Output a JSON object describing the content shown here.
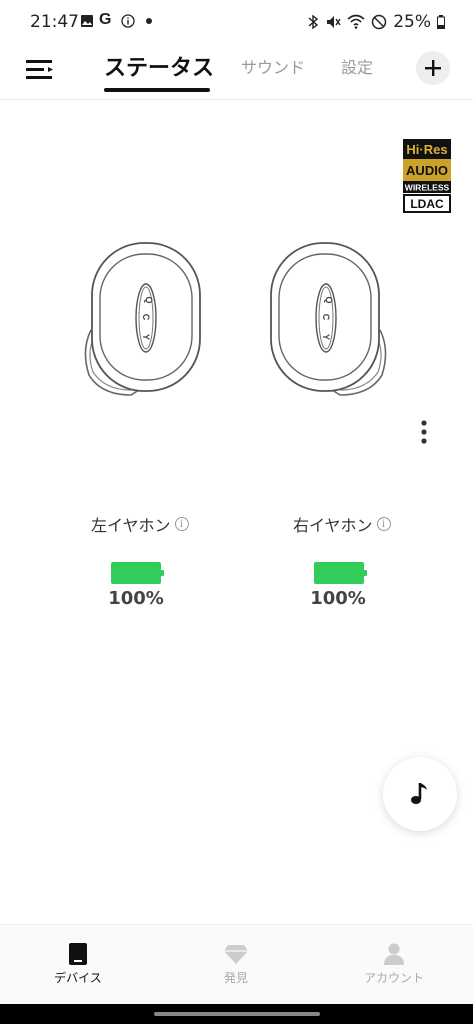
{
  "status_bar": {
    "time": "21:47",
    "battery_text": "25%",
    "icons": [
      "image-icon",
      "google-icon",
      "info-icon",
      "dot-icon",
      "bluetooth-icon",
      "mute-icon",
      "wifi-icon",
      "dnd-icon",
      "battery-icon"
    ]
  },
  "header": {
    "tabs": [
      {
        "label": "ステータス",
        "active": true
      },
      {
        "label": "サウンド",
        "active": false
      },
      {
        "label": "設定",
        "active": false
      }
    ]
  },
  "badge": {
    "line1": "Hi·Res",
    "line2": "AUDIO",
    "line3": "WIRELESS",
    "line4": "LDAC"
  },
  "earbuds": {
    "left": {
      "label": "左イヤホン",
      "battery": "100%",
      "battery_level": 1.0
    },
    "right": {
      "label": "右イヤホン",
      "battery": "100%",
      "battery_level": 1.0
    },
    "logo_text": "QCY"
  },
  "bottom_nav": {
    "items": [
      {
        "label": "デバイス",
        "icon": "device-icon",
        "active": true
      },
      {
        "label": "発見",
        "icon": "diamond-icon",
        "active": false
      },
      {
        "label": "アカウント",
        "icon": "person-icon",
        "active": false
      }
    ]
  },
  "colors": {
    "battery_green": "#33cc5a",
    "accent": "#111111",
    "badge_gold": "#c9a227"
  }
}
